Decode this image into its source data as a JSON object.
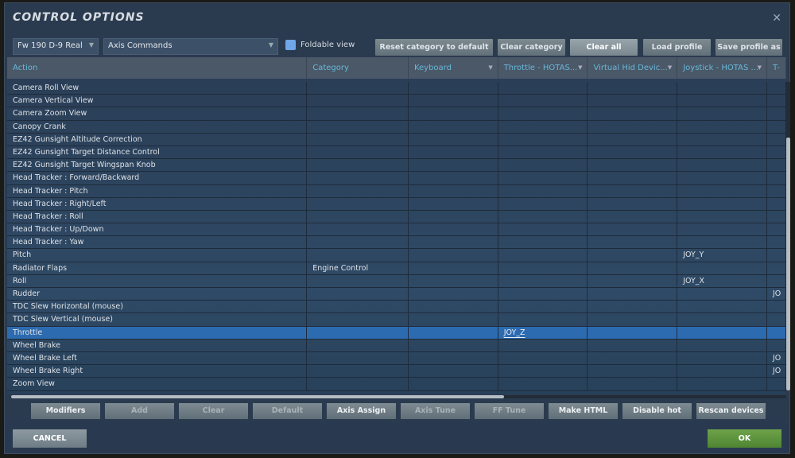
{
  "title": "CONTROL OPTIONS",
  "aircraft_select": "Fw 190 D-9 Real",
  "category_select": "Axis Commands",
  "foldable_label": "Foldable view",
  "toolbar": [
    "Reset category to default",
    "Clear category",
    "Clear all",
    "Load profile",
    "Save profile as"
  ],
  "columns": [
    "Action",
    "Category",
    "Keyboard",
    "Throttle - HOTAS...",
    "Virtual Hid Devic...",
    "Joystick - HOTAS ...",
    "T-"
  ],
  "rows": [
    [
      "Camera Roll View",
      "",
      "",
      "",
      "",
      "",
      ""
    ],
    [
      "Camera Vertical View",
      "",
      "",
      "",
      "",
      "",
      ""
    ],
    [
      "Camera Zoom View",
      "",
      "",
      "",
      "",
      "",
      ""
    ],
    [
      "Canopy Crank",
      "",
      "",
      "",
      "",
      "",
      ""
    ],
    [
      "EZ42 Gunsight Altitude Correction",
      "",
      "",
      "",
      "",
      "",
      ""
    ],
    [
      "EZ42 Gunsight Target Distance Control",
      "",
      "",
      "",
      "",
      "",
      ""
    ],
    [
      "EZ42 Gunsight Target Wingspan Knob",
      "",
      "",
      "",
      "",
      "",
      ""
    ],
    [
      "Head Tracker : Forward/Backward",
      "",
      "",
      "",
      "",
      "",
      ""
    ],
    [
      "Head Tracker : Pitch",
      "",
      "",
      "",
      "",
      "",
      ""
    ],
    [
      "Head Tracker : Right/Left",
      "",
      "",
      "",
      "",
      "",
      ""
    ],
    [
      "Head Tracker : Roll",
      "",
      "",
      "",
      "",
      "",
      ""
    ],
    [
      "Head Tracker : Up/Down",
      "",
      "",
      "",
      "",
      "",
      ""
    ],
    [
      "Head Tracker : Yaw",
      "",
      "",
      "",
      "",
      "",
      ""
    ],
    [
      "Pitch",
      "",
      "",
      "",
      "",
      "JOY_Y",
      ""
    ],
    [
      "Radiator Flaps",
      "Engine Control",
      "",
      "",
      "",
      "",
      ""
    ],
    [
      "Roll",
      "",
      "",
      "",
      "",
      "JOY_X",
      ""
    ],
    [
      "Rudder",
      "",
      "",
      "",
      "",
      "",
      "JO"
    ],
    [
      "TDC Slew Horizontal (mouse)",
      "",
      "",
      "",
      "",
      "",
      ""
    ],
    [
      "TDC Slew Vertical (mouse)",
      "",
      "",
      "",
      "",
      "",
      ""
    ],
    [
      "Throttle",
      "",
      "",
      "JOY_Z",
      "",
      "",
      ""
    ],
    [
      "Wheel Brake",
      "",
      "",
      "",
      "",
      "",
      ""
    ],
    [
      "Wheel Brake Left",
      "",
      "",
      "",
      "",
      "",
      "JO"
    ],
    [
      "Wheel Brake Right",
      "",
      "",
      "",
      "",
      "",
      "JO"
    ],
    [
      "Zoom View",
      "",
      "",
      "",
      "",
      "",
      ""
    ]
  ],
  "selected_row": 19,
  "buttons": [
    {
      "label": "Modifiers",
      "enabled": true
    },
    {
      "label": "Add",
      "enabled": false
    },
    {
      "label": "Clear",
      "enabled": false
    },
    {
      "label": "Default",
      "enabled": false
    },
    {
      "label": "Axis Assign",
      "enabled": true
    },
    {
      "label": "Axis Tune",
      "enabled": false
    },
    {
      "label": "FF Tune",
      "enabled": false
    },
    {
      "label": "Make HTML",
      "enabled": true
    },
    {
      "label": "Disable hot plug",
      "enabled": true
    },
    {
      "label": "Rescan devices",
      "enabled": true
    }
  ],
  "cancel_label": "CANCEL",
  "ok_label": "OK"
}
